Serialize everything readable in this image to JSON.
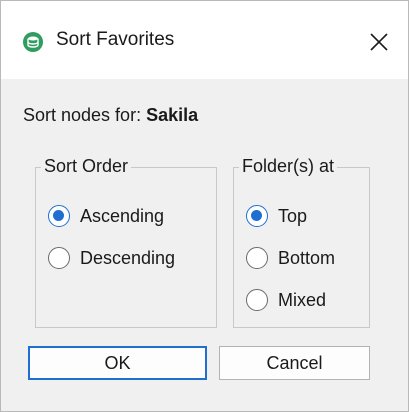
{
  "window": {
    "title": "Sort Favorites",
    "icon": "database-favorites-icon",
    "icon_color": "#2e9d5f"
  },
  "sort_label": {
    "prefix": "Sort nodes for:",
    "target": "Sakila"
  },
  "sort_order": {
    "legend": "Sort Order",
    "options": [
      {
        "label": "Ascending",
        "checked": true
      },
      {
        "label": "Descending",
        "checked": false
      }
    ]
  },
  "folders_at": {
    "legend": "Folder(s) at",
    "options": [
      {
        "label": "Top",
        "checked": true
      },
      {
        "label": "Bottom",
        "checked": false
      },
      {
        "label": "Mixed",
        "checked": false
      }
    ]
  },
  "buttons": {
    "ok": "OK",
    "cancel": "Cancel"
  },
  "colors": {
    "accent": "#1f6fd1",
    "dialog_bg": "#f0f0f0"
  }
}
